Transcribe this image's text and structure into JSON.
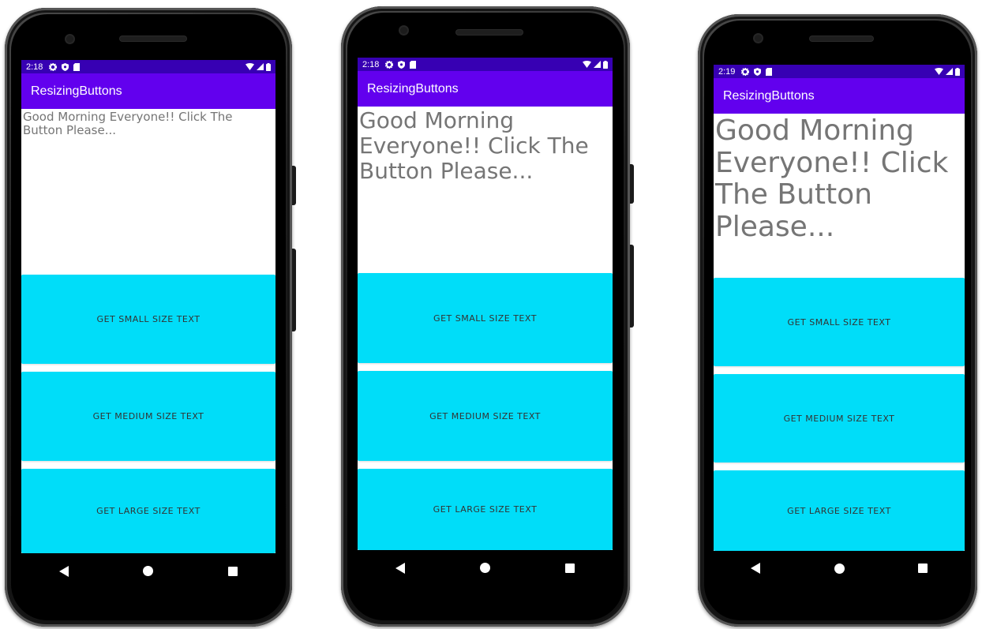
{
  "phones": [
    {
      "status_time": "2:18",
      "app_title": "ResizingButtons",
      "greeting": "Good Morning Everyone!! Click The Button Please...",
      "buttons": [
        "GET SMALL SIZE TEXT",
        "GET MEDIUM SIZE TEXT",
        "GET LARGE SIZE TEXT"
      ]
    },
    {
      "status_time": "2:18",
      "app_title": "ResizingButtons",
      "greeting": "Good Morning Everyone!! Click The Button Please...",
      "buttons": [
        "GET SMALL SIZE TEXT",
        "GET MEDIUM SIZE TEXT",
        "GET LARGE SIZE TEXT"
      ]
    },
    {
      "status_time": "2:19",
      "app_title": "ResizingButtons",
      "greeting": "Good Morning Everyone!! Click The Button Please...",
      "buttons": [
        "GET SMALL SIZE TEXT",
        "GET MEDIUM SIZE TEXT",
        "GET LARGE SIZE TEXT"
      ]
    }
  ],
  "icons": {
    "status_left": [
      "gear-icon",
      "shield-icon",
      "sd-card-icon"
    ],
    "status_right": [
      "wifi-icon",
      "signal-icon",
      "battery-icon"
    ],
    "nav": [
      "back-icon",
      "home-icon",
      "recents-icon"
    ]
  },
  "colors": {
    "status_bar": "#3700b3",
    "app_bar": "#6200ee",
    "button": "#00ddf9",
    "greeting_text": "#757575"
  }
}
